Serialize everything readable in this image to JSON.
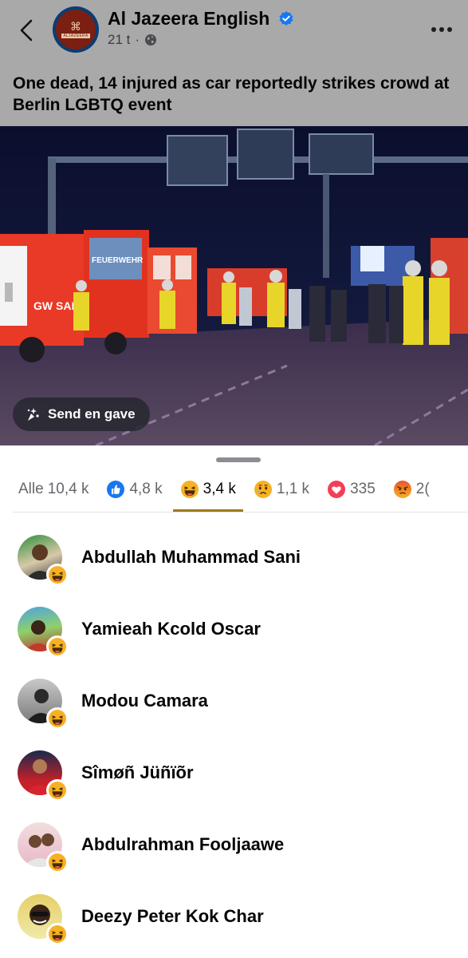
{
  "post": {
    "page_name": "Al Jazeera English",
    "avatar_text": "ALJAZEERA",
    "time": "21 t",
    "separator": "·",
    "text": "One dead, 14 injured as car reportedly strikes crowd at Berlin LGBTQ event",
    "photo_texts": {
      "truck_label": "GW SAN",
      "truck_banner": "FEUERWEHR"
    },
    "gift_button": "Send en gave"
  },
  "reactions": {
    "tabs": [
      {
        "label": "Alle",
        "count": "10,4 k",
        "icon": null,
        "active": false
      },
      {
        "label": "",
        "count": "4,8 k",
        "icon": "like-icon",
        "active": false
      },
      {
        "label": "",
        "count": "3,4 k",
        "icon": "haha-emoji-icon",
        "active": true
      },
      {
        "label": "",
        "count": "1,1 k",
        "icon": "sad-emoji-icon",
        "active": false
      },
      {
        "label": "",
        "count": "335",
        "icon": "love-icon",
        "active": false
      },
      {
        "label": "",
        "count": "2(",
        "icon": "angry-emoji-icon",
        "active": false
      }
    ],
    "users": [
      {
        "name": "Abdullah Muhammad Sani",
        "reaction": "haha-emoji-icon"
      },
      {
        "name": "Yamieah Kcold Oscar",
        "reaction": "haha-emoji-icon"
      },
      {
        "name": "Modou Camara",
        "reaction": "haha-emoji-icon"
      },
      {
        "name": "Sîmøñ Jüñïõr",
        "reaction": "haha-emoji-icon"
      },
      {
        "name": "Abdulrahman Fooljaawe",
        "reaction": "haha-emoji-icon"
      },
      {
        "name": "Deezy Peter Kok Char",
        "reaction": "haha-emoji-icon"
      }
    ]
  },
  "colors": {
    "verified": "#1877f2",
    "like": "#1877f2",
    "love": "#f33e58",
    "haha": "#f7b125",
    "active_tab_underline": "#9c7a18"
  }
}
